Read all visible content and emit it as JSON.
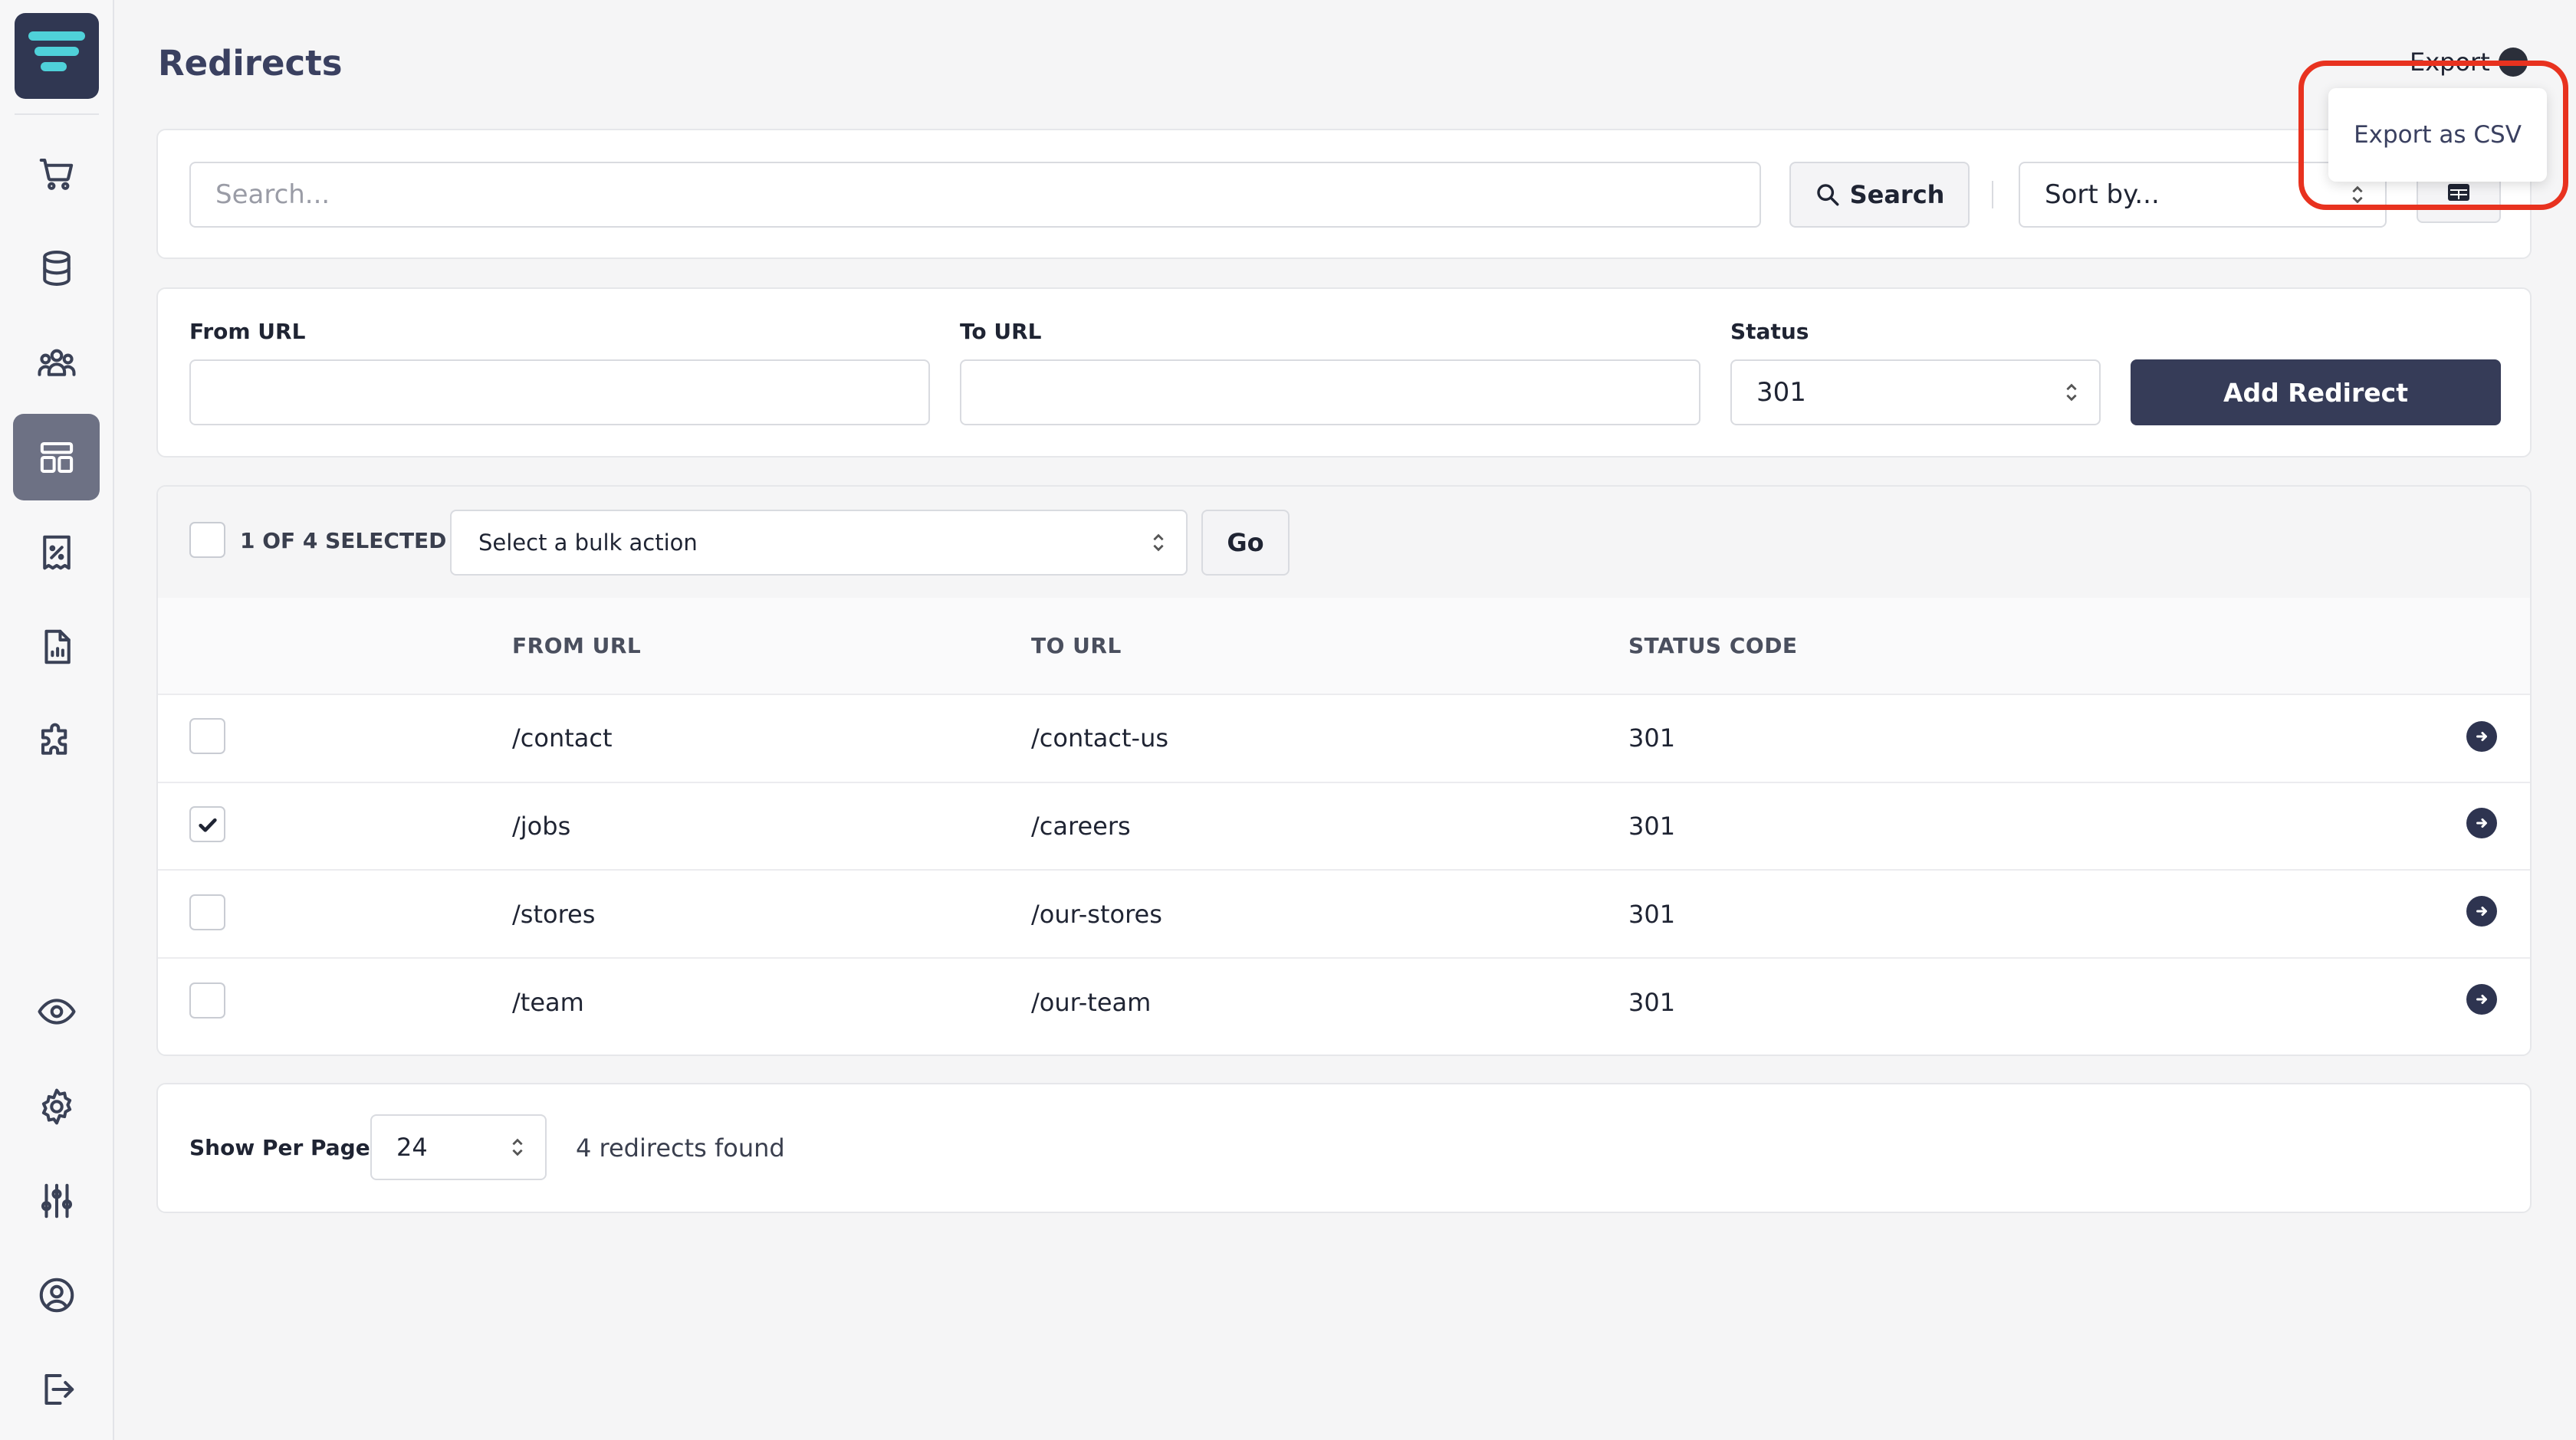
{
  "page": {
    "title": "Redirects"
  },
  "export": {
    "label": "Export",
    "menu_item": "Export as CSV"
  },
  "search": {
    "placeholder": "Search...",
    "button": "Search",
    "sort_placeholder": "Sort by..."
  },
  "form": {
    "from_label": "From URL",
    "to_label": "To URL",
    "status_label": "Status",
    "status_value": "301",
    "submit": "Add Redirect"
  },
  "bulk": {
    "selected_text": "1 OF 4 SELECTED",
    "action_placeholder": "Select a bulk action",
    "go": "Go"
  },
  "table": {
    "headers": [
      "FROM URL",
      "TO URL",
      "STATUS CODE"
    ],
    "rows": [
      {
        "from": "/contact",
        "to": "/contact-us",
        "status": "301",
        "checked": false
      },
      {
        "from": "/jobs",
        "to": "/careers",
        "status": "301",
        "checked": true
      },
      {
        "from": "/stores",
        "to": "/our-stores",
        "status": "301",
        "checked": false
      },
      {
        "from": "/team",
        "to": "/our-team",
        "status": "301",
        "checked": false
      }
    ]
  },
  "pagination": {
    "per_page_label": "Show Per Page",
    "per_page_value": "24",
    "count_text": "4 redirects found"
  },
  "sidebar": {
    "icons": [
      "cart-icon",
      "database-icon",
      "users-icon",
      "layout-icon",
      "receipt-percent-icon",
      "report-icon",
      "puzzle-icon",
      "eye-icon",
      "gear-icon",
      "sliders-icon",
      "user-circle-icon",
      "logout-icon"
    ]
  },
  "colors": {
    "brand_dark": "#363c58",
    "accent_highlight": "#e8321f",
    "logo_accent": "#4fd1d9"
  }
}
